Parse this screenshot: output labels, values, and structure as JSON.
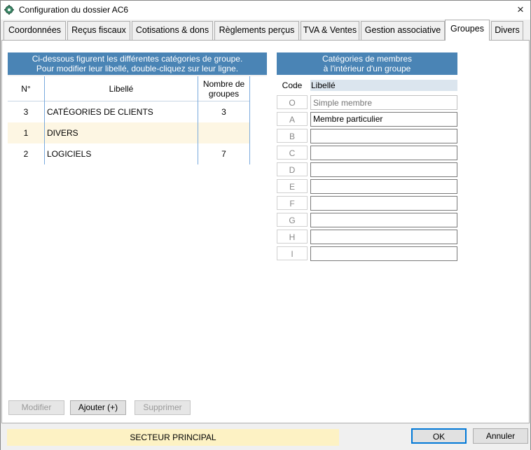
{
  "window": {
    "title": "Configuration du dossier AC6",
    "close_icon": "×"
  },
  "tabs": [
    {
      "label": "Coordonnées"
    },
    {
      "label": "Reçus fiscaux"
    },
    {
      "label": "Cotisations & dons"
    },
    {
      "label": "Règlements perçus"
    },
    {
      "label": "TVA & Ventes"
    },
    {
      "label": "Gestion associative"
    },
    {
      "label": "Groupes"
    },
    {
      "label": "Divers"
    }
  ],
  "active_tab": "Groupes",
  "left_panel": {
    "info_line1": "Ci-dessous figurent les différentes catégories de groupe.",
    "info_line2": "Pour modifier leur libellé, double-cliquez sur leur ligne.",
    "columns": {
      "num": "N°",
      "label": "Libellé",
      "count_line1": "Nombre de",
      "count_line2": "groupes"
    },
    "rows": [
      {
        "num": "3",
        "label": "CATÉGORIES DE CLIENTS",
        "count": "3"
      },
      {
        "num": "1",
        "label": "DIVERS",
        "count": ""
      },
      {
        "num": "2",
        "label": "LOGICIELS",
        "count": "7"
      }
    ],
    "buttons": {
      "modify": "Modifier",
      "add": "Ajouter (+)",
      "delete": "Supprimer"
    }
  },
  "right_panel": {
    "title_line1": "Catégories de membres",
    "title_line2": "à l'intérieur d'un groupe",
    "col_code": "Code",
    "col_label": "Libellé",
    "categories": [
      {
        "code": "O",
        "label": "",
        "placeholder": "Simple membre"
      },
      {
        "code": "A",
        "label": "Membre particulier",
        "placeholder": ""
      },
      {
        "code": "B",
        "label": "",
        "placeholder": ""
      },
      {
        "code": "C",
        "label": "",
        "placeholder": ""
      },
      {
        "code": "D",
        "label": "",
        "placeholder": ""
      },
      {
        "code": "E",
        "label": "",
        "placeholder": ""
      },
      {
        "code": "F",
        "label": "",
        "placeholder": ""
      },
      {
        "code": "G",
        "label": "",
        "placeholder": ""
      },
      {
        "code": "H",
        "label": "",
        "placeholder": ""
      },
      {
        "code": "I",
        "label": "",
        "placeholder": ""
      }
    ]
  },
  "footer": {
    "sector": "SECTEUR PRINCIPAL",
    "ok": "OK",
    "cancel": "Annuler"
  },
  "colors": {
    "header_blue": "#4a84b5",
    "row_highlight": "#fdf6e3",
    "sector_bg": "#fdf2c4"
  }
}
